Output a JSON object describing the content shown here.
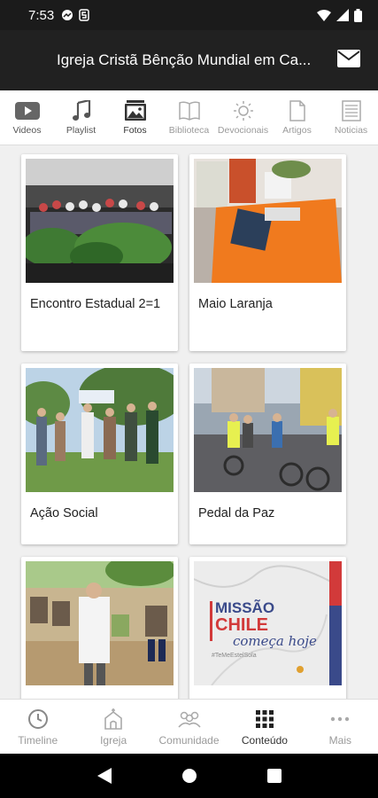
{
  "status_bar": {
    "time": "7:53"
  },
  "app_bar": {
    "title": "Igreja Cristã Bênção Mundial em Ca...",
    "mail_icon": "mail-icon"
  },
  "tabs": [
    {
      "label": "Videos",
      "icon": "video-icon"
    },
    {
      "label": "Playlist",
      "icon": "music-note-icon"
    },
    {
      "label": "Fotos",
      "icon": "photo-icon",
      "active": true
    },
    {
      "label": "Biblioteca",
      "icon": "book-icon"
    },
    {
      "label": "Devocionais",
      "icon": "sun-icon"
    },
    {
      "label": "Artigos",
      "icon": "document-icon"
    },
    {
      "label": "Noticias",
      "icon": "news-icon"
    }
  ],
  "albums": [
    {
      "caption": "Encontro Estadual 2=1"
    },
    {
      "caption": "Maio Laranja"
    },
    {
      "caption": "Ação Social"
    },
    {
      "caption": "Pedal da Paz"
    },
    {
      "caption": ""
    },
    {
      "caption": ""
    }
  ],
  "poster": {
    "line1": "MISSÃO",
    "line2": "CHILE",
    "line3": "começa hoje",
    "hashtag": "#TeMeEstelSola"
  },
  "bottom_nav": [
    {
      "label": "Timeline",
      "icon": "clock-icon"
    },
    {
      "label": "Igreja",
      "icon": "church-icon"
    },
    {
      "label": "Comunidade",
      "icon": "community-icon"
    },
    {
      "label": "Conteúdo",
      "icon": "grid-icon",
      "active": true
    },
    {
      "label": "Mais",
      "icon": "more-icon"
    }
  ],
  "colors": {
    "app_bar": "#212121",
    "status_bar": "#1b1b1b",
    "active": "#333333",
    "inactive": "#9a9a9a"
  }
}
